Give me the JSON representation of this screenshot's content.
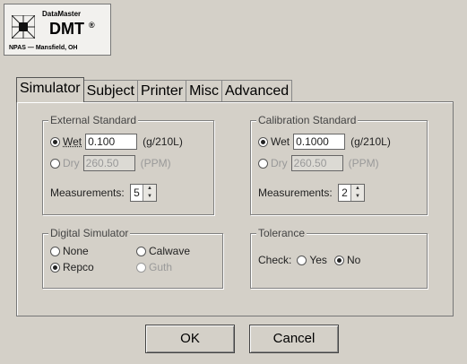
{
  "logo": {
    "brand": "DataMaster",
    "model": "DMT",
    "mark": "®",
    "sub": "NPAS — Mansfield, OH"
  },
  "tabs": [
    "Simulator",
    "Subject",
    "Printer",
    "Misc",
    "Advanced"
  ],
  "active_tab": "Simulator",
  "external_standard": {
    "title": "External Standard",
    "wet_label": "Wet",
    "wet_value": "0.100",
    "wet_unit": "(g/210L)",
    "dry_label": "Dry",
    "dry_value": "260.50",
    "dry_unit": "(PPM)",
    "selected": "Wet",
    "measurements_label": "Measurements:",
    "measurements_value": "5"
  },
  "calibration_standard": {
    "title": "Calibration Standard",
    "wet_label": "Wet",
    "wet_value": "0.1000",
    "wet_unit": "(g/210L)",
    "dry_label": "Dry",
    "dry_value": "260.50",
    "dry_unit": "(PPM)",
    "selected": "Wet",
    "measurements_label": "Measurements:",
    "measurements_value": "2"
  },
  "digital_simulator": {
    "title": "Digital Simulator",
    "options": [
      "None",
      "Calwave",
      "Repco",
      "Guth"
    ],
    "selected": "Repco"
  },
  "tolerance": {
    "title": "Tolerance",
    "check_label": "Check:",
    "yes_label": "Yes",
    "no_label": "No",
    "selected": "No"
  },
  "buttons": {
    "ok": "OK",
    "cancel": "Cancel"
  }
}
